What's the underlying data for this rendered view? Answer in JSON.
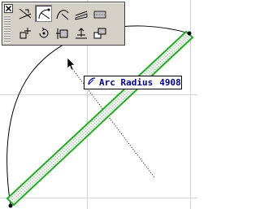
{
  "tooltip": {
    "icon": "arc-radius-icon",
    "label": "Arc Radius",
    "value": "4908",
    "color": "#000080"
  },
  "palette": {
    "close_icon": "close-icon",
    "tools": [
      {
        "icon": "angle-lines-icon",
        "active": false
      },
      {
        "icon": "arc-tangent-icon",
        "active": true
      },
      {
        "icon": "arc-curve-icon",
        "active": false
      },
      {
        "icon": "hatch-slab-icon",
        "active": false
      },
      {
        "icon": "hatch-fill-icon",
        "active": false
      },
      {
        "icon": "move-node-icon",
        "active": false
      },
      {
        "icon": "rotate-node-icon",
        "active": false
      },
      {
        "icon": "offset-edge-icon",
        "active": false
      },
      {
        "icon": "elevation-icon",
        "active": false
      },
      {
        "icon": "copy-window-icon",
        "active": false
      }
    ]
  },
  "colors": {
    "selection": "#22aa22",
    "grid": "#d4d4d4",
    "palette_bg": "#d4d0c8"
  }
}
